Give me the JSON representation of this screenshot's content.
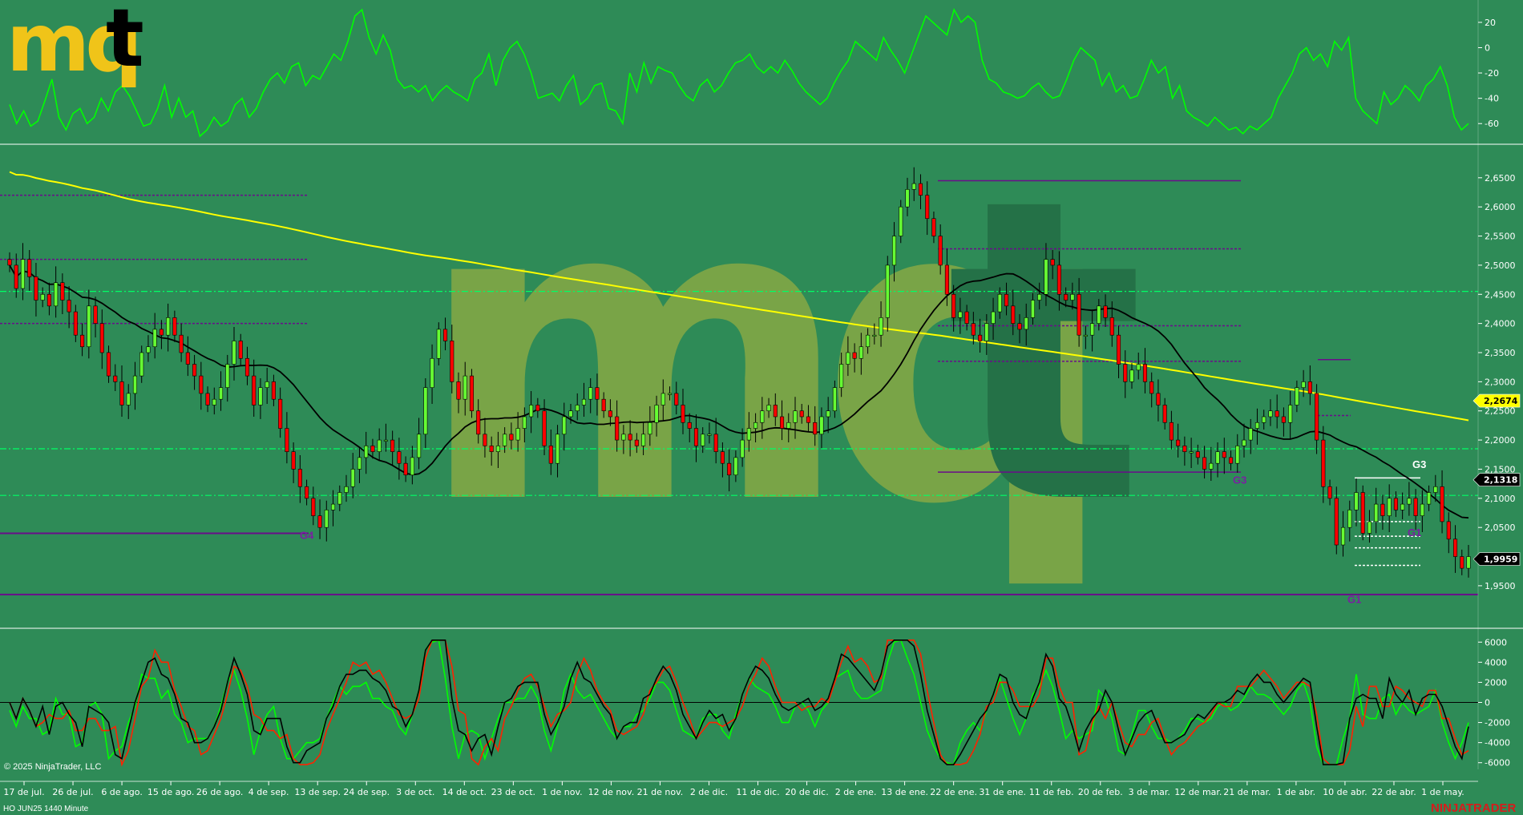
{
  "logo": {
    "text_m": "mq",
    "text_t": "t"
  },
  "copyright": "© 2025 NinjaTrader, LLC",
  "instrument": "HO JUN25 1440 Minute",
  "brand": "NINJATRADER",
  "colors": {
    "background": "#2e8b57",
    "bull": "#66ff33",
    "bear": "#ff0000",
    "sma_fast": "#000000",
    "sma_slow": "#ffff00",
    "level_green": "#00ff66",
    "level_purple": "#6a0d8a",
    "osc_green": "#00ff00",
    "osc_red": "#ff2200",
    "osc_black": "#000000"
  },
  "chart_data": [
    {
      "type": "line",
      "panel": "top-oscillator",
      "ylim": [
        -70,
        25
      ],
      "yticks": [
        "20",
        "0",
        "-20",
        "-40",
        "-60"
      ],
      "series": [
        {
          "color": "#00ff00",
          "values": [
            -45,
            -60,
            -50,
            -62,
            -58,
            -42,
            -25,
            -55,
            -65,
            -52,
            -48,
            -60,
            -55,
            -40,
            -50,
            -35,
            -30,
            -38,
            -50,
            -62,
            -60,
            -48,
            -30,
            -55,
            -40,
            -55,
            -50,
            -70,
            -65,
            -55,
            -62,
            -58,
            -45,
            -40,
            -55,
            -48,
            -35,
            -25,
            -20,
            -28,
            -15,
            -12,
            -30,
            -22,
            -25,
            -15,
            -5,
            -10,
            5,
            25,
            30,
            8,
            -5,
            10,
            -2,
            -25,
            -32,
            -30,
            -35,
            -30,
            -42,
            -35,
            -30,
            -35,
            -38,
            -42,
            -25,
            -20,
            -5,
            -30,
            -10,
            0,
            5,
            -5,
            -20,
            -40,
            -38,
            -36,
            -42,
            -30,
            -22,
            -45,
            -40,
            -30,
            -28,
            -48,
            -50,
            -60,
            -20,
            -35,
            -12,
            -28,
            -15,
            -18,
            -20,
            -30,
            -38,
            -42,
            -30,
            -25,
            -35,
            -30,
            -20,
            -12,
            -10,
            -5,
            -15,
            -20,
            -15,
            -20,
            -10,
            -18,
            -28,
            -35,
            -40,
            -45,
            -40,
            -28,
            -18,
            -10,
            5,
            0,
            -5,
            -10,
            8,
            -2,
            -10,
            -20,
            -5,
            10,
            25,
            20,
            15,
            10,
            30,
            20,
            25,
            20,
            -10,
            -25,
            -28,
            -35,
            -37,
            -40,
            -38,
            -32,
            -28,
            -35,
            -40,
            -38,
            -25,
            -10,
            0,
            -5,
            -10,
            -30,
            -20,
            -35,
            -30,
            -40,
            -38,
            -25,
            -10,
            -20,
            -15,
            -40,
            -30,
            -50,
            -55,
            -58,
            -62,
            -55,
            -60,
            -65,
            -63,
            -68,
            -62,
            -65,
            -60,
            -55,
            -40,
            -30,
            -20,
            -5,
            0,
            -10,
            -5,
            -15,
            5,
            -2,
            8,
            -40,
            -50,
            -55,
            -60,
            -35,
            -45,
            -40,
            -30,
            -35,
            -42,
            -30,
            -25,
            -15,
            -30,
            -55,
            -65,
            -60
          ]
        }
      ]
    },
    {
      "type": "candlestick",
      "panel": "price",
      "ylim": [
        1.91,
        2.68
      ],
      "yticks": [
        "2,6500",
        "2,6000",
        "2,5500",
        "2,5000",
        "2,4500",
        "2,4000",
        "2,3500",
        "2,3000",
        "2,2500",
        "2,2000",
        "2,1500",
        "2,1000",
        "2,0500",
        "2,0000",
        "1,9500"
      ],
      "x_labels": [
        "17 de jul.",
        "26 de jul.",
        "6 de ago.",
        "15 de ago.",
        "26 de ago.",
        "4 de sep.",
        "13 de sep.",
        "24 de sep.",
        "3 de oct.",
        "14 de oct.",
        "23 de oct.",
        "1 de nov.",
        "12 de nov.",
        "21 de nov.",
        "2 de dic.",
        "11 de dic.",
        "20 de dic.",
        "2 de ene.",
        "13 de ene.",
        "22 de ene.",
        "31 de ene.",
        "11 de feb.",
        "20 de feb.",
        "3 de mar.",
        "12 de mar.",
        "21 de mar.",
        "1 de abr.",
        "10 de abr.",
        "22 de abr.",
        "1 de may."
      ],
      "close": [
        2.5,
        2.46,
        2.51,
        2.48,
        2.44,
        2.45,
        2.43,
        2.47,
        2.44,
        2.42,
        2.38,
        2.36,
        2.43,
        2.4,
        2.35,
        2.31,
        2.3,
        2.26,
        2.28,
        2.31,
        2.35,
        2.36,
        2.39,
        2.38,
        2.41,
        2.38,
        2.35,
        2.33,
        2.31,
        2.28,
        2.26,
        2.27,
        2.29,
        2.33,
        2.37,
        2.34,
        2.31,
        2.26,
        2.29,
        2.3,
        2.27,
        2.22,
        2.18,
        2.15,
        2.12,
        2.1,
        2.07,
        2.05,
        2.08,
        2.09,
        2.11,
        2.12,
        2.15,
        2.17,
        2.19,
        2.18,
        2.2,
        2.2,
        2.18,
        2.16,
        2.14,
        2.17,
        2.21,
        2.29,
        2.34,
        2.39,
        2.37,
        2.3,
        2.27,
        2.31,
        2.25,
        2.21,
        2.19,
        2.18,
        2.19,
        2.21,
        2.2,
        2.22,
        2.24,
        2.26,
        2.25,
        2.19,
        2.16,
        2.21,
        2.24,
        2.25,
        2.26,
        2.27,
        2.29,
        2.27,
        2.25,
        2.24,
        2.2,
        2.21,
        2.2,
        2.19,
        2.21,
        2.23,
        2.26,
        2.28,
        2.28,
        2.26,
        2.23,
        2.22,
        2.19,
        2.21,
        2.21,
        2.18,
        2.16,
        2.14,
        2.17,
        2.2,
        2.22,
        2.23,
        2.25,
        2.26,
        2.24,
        2.22,
        2.23,
        2.25,
        2.24,
        2.23,
        2.21,
        2.24,
        2.25,
        2.29,
        2.33,
        2.35,
        2.34,
        2.36,
        2.38,
        2.38,
        2.41,
        2.5,
        2.55,
        2.6,
        2.63,
        2.64,
        2.62,
        2.58,
        2.55,
        2.5,
        2.45,
        2.41,
        2.42,
        2.4,
        2.38,
        2.37,
        2.4,
        2.42,
        2.45,
        2.43,
        2.4,
        2.39,
        2.41,
        2.44,
        2.45,
        2.51,
        2.5,
        2.45,
        2.44,
        2.45,
        2.38,
        2.38,
        2.4,
        2.43,
        2.41,
        2.38,
        2.33,
        2.3,
        2.32,
        2.33,
        2.3,
        2.28,
        2.26,
        2.23,
        2.2,
        2.19,
        2.18,
        2.18,
        2.17,
        2.15,
        2.16,
        2.18,
        2.17,
        2.16,
        2.19,
        2.2,
        2.22,
        2.23,
        2.24,
        2.25,
        2.24,
        2.23,
        2.26,
        2.29,
        2.3,
        2.28,
        2.2,
        2.12,
        2.1,
        2.02,
        2.05,
        2.08,
        2.11,
        2.04,
        2.06,
        2.09,
        2.07,
        2.1,
        2.08,
        2.09,
        2.1,
        2.07,
        2.09,
        2.11,
        2.12,
        2.06,
        2.03,
        2.0,
        1.98,
        2.0
      ]
    },
    {
      "type": "line",
      "panel": "bottom-oscillator",
      "ylim": [
        -6500,
        6500
      ],
      "yticks": [
        "6000",
        "4000",
        "2000",
        "0",
        "-2000",
        "-4000",
        "-6000"
      ],
      "series": [
        {
          "color": "#00ff00"
        },
        {
          "color": "#ff2200"
        },
        {
          "color": "#000000"
        }
      ]
    }
  ],
  "price_tags": [
    {
      "label": "2,2674",
      "value": 2.2674,
      "bg": "#ffff00",
      "fg": "#000000"
    },
    {
      "label": "2,1318",
      "value": 2.1318,
      "bg": "#000000",
      "fg": "#ffffff"
    },
    {
      "label": "1,9959",
      "value": 1.9959,
      "bg": "#000000",
      "fg": "#ffffff"
    }
  ],
  "wave_labels": [
    {
      "text": "G4",
      "color": "#7a1fa2"
    },
    {
      "text": "G3",
      "color": "#7a1fa2"
    },
    {
      "text": "G3",
      "color": "#ffffff"
    },
    {
      "text": "G1",
      "color": "#7a1fa2"
    },
    {
      "text": "G1",
      "color": "#7a1fa2"
    }
  ]
}
